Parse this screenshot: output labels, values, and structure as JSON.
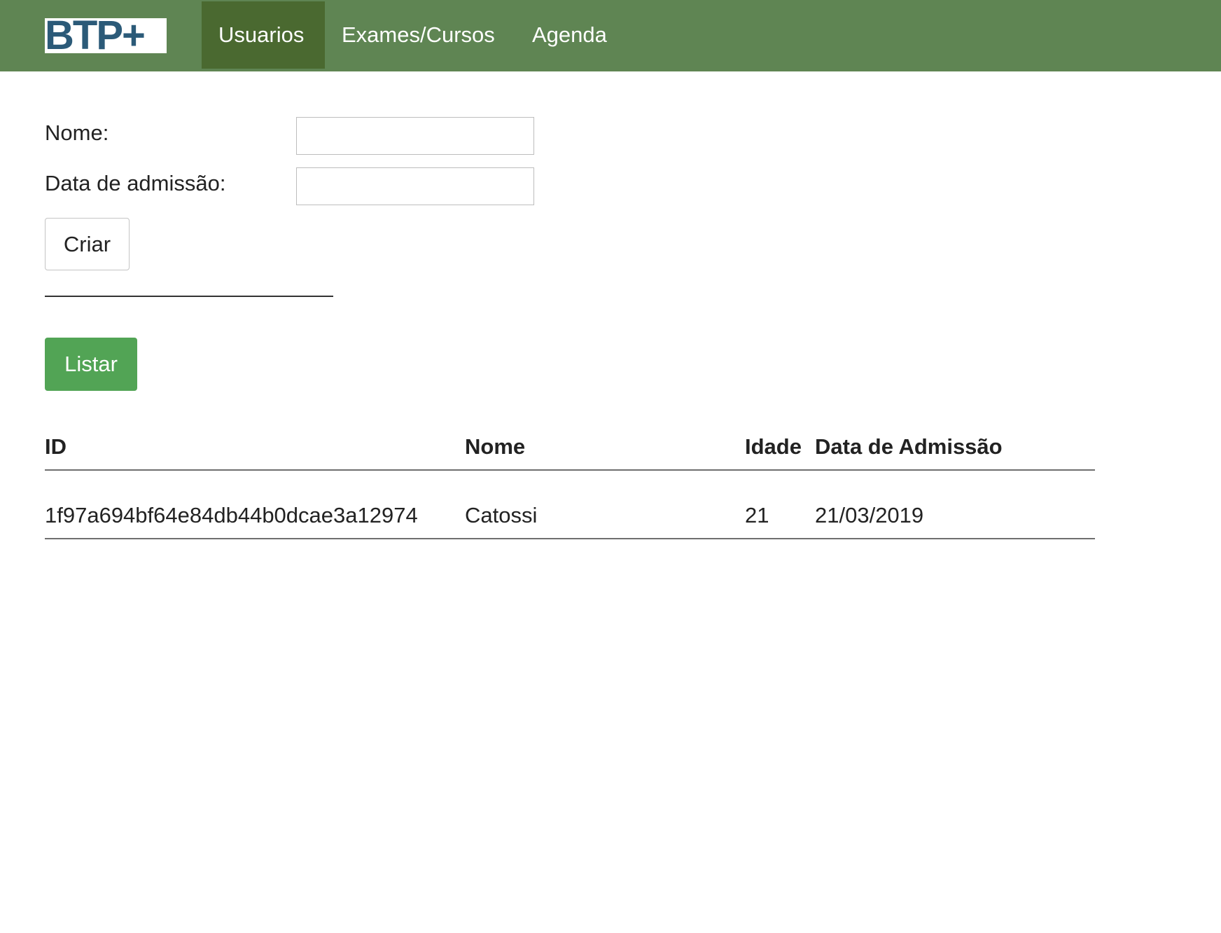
{
  "navbar": {
    "logo_text": "BTP+",
    "items": [
      {
        "label": "Usuarios",
        "active": true
      },
      {
        "label": "Exames/Cursos",
        "active": false
      },
      {
        "label": "Agenda",
        "active": false
      }
    ],
    "background_color": "#5f8553",
    "active_color": "#4a6930"
  },
  "form": {
    "nome_label": "Nome:",
    "nome_value": "",
    "data_label": "Data de admissão:",
    "data_value": "",
    "criar_label": "Criar",
    "separator_text": "________________________"
  },
  "listar": {
    "label": "Listar",
    "color": "#52a455"
  },
  "table": {
    "headers": [
      "ID",
      "Nome",
      "Idade",
      "Data de Admissão"
    ],
    "rows": [
      [
        "1f97a694bf64e84db44b0dcae3a12974",
        "Catossi",
        "21",
        "21/03/2019"
      ]
    ]
  }
}
